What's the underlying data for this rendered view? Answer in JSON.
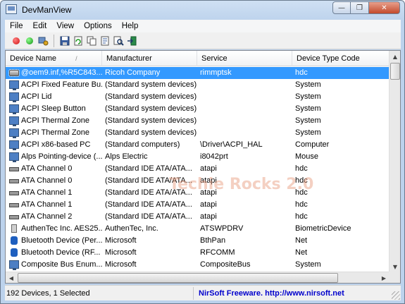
{
  "window": {
    "title": "DevManView",
    "minimize_glyph": "—",
    "maximize_glyph": "❐",
    "close_glyph": "✕"
  },
  "menu": [
    "File",
    "Edit",
    "View",
    "Options",
    "Help"
  ],
  "toolbar": {
    "buttons": [
      {
        "icon": "disable-device-icon",
        "color": "#e02020"
      },
      {
        "icon": "enable-device-icon",
        "color": "#18b818"
      },
      {
        "icon": "device-properties-icon"
      },
      {
        "icon": "save-icon"
      },
      {
        "icon": "refresh-icon"
      },
      {
        "icon": "copy-icon"
      },
      {
        "icon": "html-report-icon"
      },
      {
        "icon": "find-icon"
      },
      {
        "icon": "exit-icon"
      }
    ]
  },
  "columns": [
    "Device Name",
    "Manufacturer",
    "Service",
    "Device Type Code"
  ],
  "sort_indicator": "/",
  "rows": [
    {
      "name": "@oem9.inf,%R5C843...",
      "manufacturer": "Ricoh Company",
      "service": "rimmptsk",
      "type": "hdc",
      "icon": "storage-controller-icon",
      "selected": true
    },
    {
      "name": "ACPI Fixed Feature Bu...",
      "manufacturer": "(Standard system devices)",
      "service": "",
      "type": "System",
      "icon": "system-device-icon"
    },
    {
      "name": "ACPI Lid",
      "manufacturer": "(Standard system devices)",
      "service": "",
      "type": "System",
      "icon": "system-device-icon"
    },
    {
      "name": "ACPI Sleep Button",
      "manufacturer": "(Standard system devices)",
      "service": "",
      "type": "System",
      "icon": "system-device-icon"
    },
    {
      "name": "ACPI Thermal Zone",
      "manufacturer": "(Standard system devices)",
      "service": "",
      "type": "System",
      "icon": "system-device-icon"
    },
    {
      "name": "ACPI Thermal Zone",
      "manufacturer": "(Standard system devices)",
      "service": "",
      "type": "System",
      "icon": "system-device-icon"
    },
    {
      "name": "ACPI x86-based PC",
      "manufacturer": "(Standard computers)",
      "service": "\\Driver\\ACPI_HAL",
      "type": "Computer",
      "icon": "computer-icon"
    },
    {
      "name": "Alps Pointing-device (...",
      "manufacturer": "Alps Electric",
      "service": "i8042prt",
      "type": "Mouse",
      "icon": "mouse-icon"
    },
    {
      "name": "ATA Channel 0",
      "manufacturer": "(Standard IDE ATA/ATA...",
      "service": "atapi",
      "type": "hdc",
      "icon": "ide-channel-icon"
    },
    {
      "name": "ATA Channel 0",
      "manufacturer": "(Standard IDE ATA/ATA...",
      "service": "atapi",
      "type": "hdc",
      "icon": "ide-channel-icon"
    },
    {
      "name": "ATA Channel 1",
      "manufacturer": "(Standard IDE ATA/ATA...",
      "service": "atapi",
      "type": "hdc",
      "icon": "ide-channel-icon"
    },
    {
      "name": "ATA Channel 1",
      "manufacturer": "(Standard IDE ATA/ATA...",
      "service": "atapi",
      "type": "hdc",
      "icon": "ide-channel-icon"
    },
    {
      "name": "ATA Channel 2",
      "manufacturer": "(Standard IDE ATA/ATA...",
      "service": "atapi",
      "type": "hdc",
      "icon": "ide-channel-icon"
    },
    {
      "name": "AuthenTec Inc. AES25...",
      "manufacturer": "AuthenTec, Inc.",
      "service": "ATSWPDRV",
      "type": "BiometricDevice",
      "icon": "fingerprint-reader-icon"
    },
    {
      "name": "Bluetooth Device (Per...",
      "manufacturer": "Microsoft",
      "service": "BthPan",
      "type": "Net",
      "icon": "bluetooth-icon"
    },
    {
      "name": "Bluetooth Device (RF...",
      "manufacturer": "Microsoft",
      "service": "RFCOMM",
      "type": "Net",
      "icon": "bluetooth-icon"
    },
    {
      "name": "Composite Bus Enum...",
      "manufacturer": "Microsoft",
      "service": "CompositeBus",
      "type": "System",
      "icon": "system-device-icon"
    }
  ],
  "watermark": "Techie Rocks 2.0",
  "status": {
    "left": "192 Devices, 1 Selected",
    "right": "NirSoft Freeware.  http://www.nirsoft.net"
  }
}
